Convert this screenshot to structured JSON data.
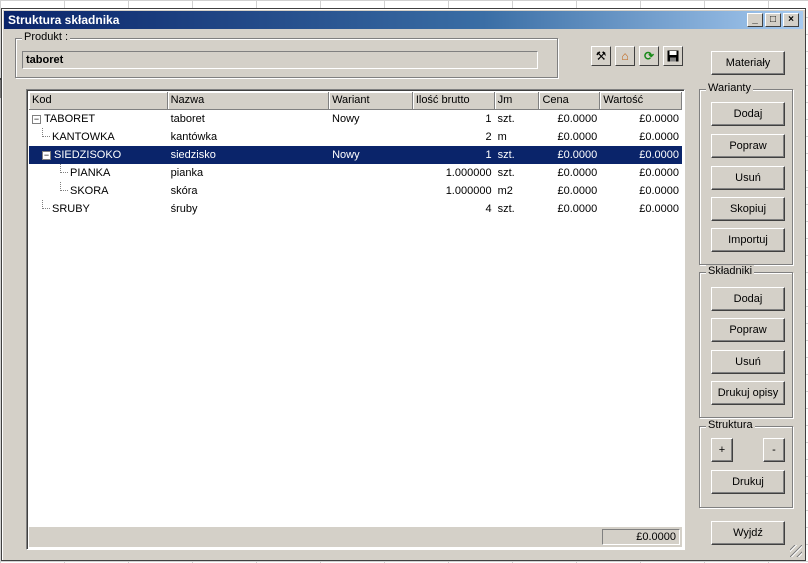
{
  "window": {
    "title": "Struktura składnika"
  },
  "produkt": {
    "legend": "Produkt :",
    "value": "taboret"
  },
  "toolbar": {
    "icons": [
      "tools-icon",
      "home-icon",
      "refresh-icon",
      "save-icon"
    ]
  },
  "grid": {
    "columns": [
      "Kod",
      "Nazwa",
      "Wariant",
      "Ilość brutto",
      "Jm",
      "Cena",
      "Wartość"
    ],
    "rows": [
      {
        "kod": "TABORET",
        "nazwa": "taboret",
        "wariant": "Nowy",
        "ilosc": "1",
        "jm": "szt.",
        "cena": "£0.0000",
        "wartosc": "£0.0000",
        "level": 0,
        "expander": "−",
        "selected": false
      },
      {
        "kod": "KANTOWKA",
        "nazwa": "kantówka",
        "wariant": "",
        "ilosc": "2",
        "jm": "m",
        "cena": "£0.0000",
        "wartosc": "£0.0000",
        "level": 1,
        "expander": "",
        "selected": false
      },
      {
        "kod": "SIEDZISOKO",
        "nazwa": "siedzisko",
        "wariant": "Nowy",
        "ilosc": "1",
        "jm": "szt.",
        "cena": "£0.0000",
        "wartosc": "£0.0000",
        "level": 1,
        "expander": "−",
        "selected": true
      },
      {
        "kod": "PIANKA",
        "nazwa": "pianka",
        "wariant": "",
        "ilosc": "1.000000",
        "jm": "szt.",
        "cena": "£0.0000",
        "wartosc": "£0.0000",
        "level": 2,
        "expander": "",
        "selected": false
      },
      {
        "kod": "SKORA",
        "nazwa": "skóra",
        "wariant": "",
        "ilosc": "1.000000",
        "jm": "m2",
        "cena": "£0.0000",
        "wartosc": "£0.0000",
        "level": 2,
        "expander": "",
        "selected": false
      },
      {
        "kod": "SRUBY",
        "nazwa": "śruby",
        "wariant": "",
        "ilosc": "4",
        "jm": "szt.",
        "cena": "£0.0000",
        "wartosc": "£0.0000",
        "level": 1,
        "expander": "",
        "selected": false
      }
    ],
    "total": "£0.0000"
  },
  "buttons": {
    "materialy": "Materiały",
    "warianty": {
      "legend": "Warianty",
      "dodaj": "Dodaj",
      "popraw": "Popraw",
      "usun": "Usuń",
      "skopiuj": "Skopiuj",
      "importuj": "Importuj"
    },
    "skladniki": {
      "legend": "Składniki",
      "dodaj": "Dodaj",
      "popraw": "Popraw",
      "usun": "Usuń",
      "drukuj_opisy": "Drukuj opisy"
    },
    "struktura": {
      "legend": "Struktura",
      "plus": "+",
      "minus": "-",
      "drukuj": "Drukuj"
    },
    "wyjdz": "Wyjdź"
  }
}
